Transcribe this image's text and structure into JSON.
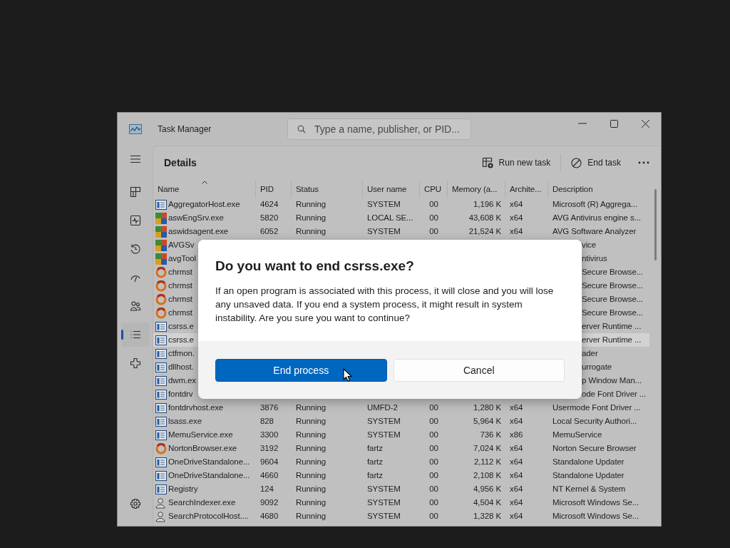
{
  "window": {
    "title": "Task Manager"
  },
  "search": {
    "placeholder": "Type a name, publisher, or PID..."
  },
  "nav": [
    {
      "kind": "menu",
      "selected": false
    },
    {
      "kind": "processes",
      "selected": false
    },
    {
      "kind": "performance",
      "selected": false
    },
    {
      "kind": "history",
      "selected": false
    },
    {
      "kind": "startup",
      "selected": false
    },
    {
      "kind": "users",
      "selected": false
    },
    {
      "kind": "details",
      "selected": true
    },
    {
      "kind": "services",
      "selected": false
    },
    {
      "kind": "settings",
      "selected": false
    }
  ],
  "page": {
    "title": "Details",
    "actions": [
      {
        "label": "Run new task",
        "kind": "run"
      },
      {
        "label": "End task",
        "kind": "end"
      }
    ]
  },
  "table": {
    "columns": [
      "Name",
      "PID",
      "Status",
      "User name",
      "CPU",
      "Memory (a...",
      "Archite...",
      "Description"
    ],
    "rows": [
      {
        "kind": "app",
        "selected": false,
        "cells": [
          "AggregatorHost.exe",
          "4624",
          "Running",
          "SYSTEM",
          "00",
          "1,196 K",
          "x64",
          "Microsoft (R) Aggrega..."
        ]
      },
      {
        "kind": "avg",
        "selected": false,
        "cells": [
          "aswEngSrv.exe",
          "5820",
          "Running",
          "LOCAL SE...",
          "00",
          "43,608 K",
          "x64",
          "AVG Antivirus engine s..."
        ]
      },
      {
        "kind": "avg",
        "selected": false,
        "cells": [
          "aswidsagent.exe",
          "6052",
          "Running",
          "SYSTEM",
          "00",
          "21,524 K",
          "x64",
          "AVG Software Analyzer"
        ]
      },
      {
        "kind": "avg",
        "selected": false,
        "cells": [
          "AVGSv",
          "vice"
        ]
      },
      {
        "kind": "avg",
        "selected": false,
        "cells": [
          "avgTool",
          "ntivirus"
        ]
      },
      {
        "kind": "ring",
        "selected": false,
        "cells": [
          "chrmst",
          "Secure Browse..."
        ]
      },
      {
        "kind": "ring",
        "selected": false,
        "cells": [
          "chrmst",
          "Secure Browse..."
        ]
      },
      {
        "kind": "ring",
        "selected": false,
        "cells": [
          "chrmst",
          "Secure Browse..."
        ]
      },
      {
        "kind": "ring",
        "selected": false,
        "cells": [
          "chrmst",
          "Secure Browse..."
        ]
      },
      {
        "kind": "app",
        "selected": false,
        "cells": [
          "csrss.e",
          "erver Runtime ..."
        ]
      },
      {
        "kind": "app",
        "selected": true,
        "cells": [
          "csrss.e",
          "erver Runtime ..."
        ]
      },
      {
        "kind": "app",
        "selected": false,
        "cells": [
          "ctfmon.",
          "ader"
        ]
      },
      {
        "kind": "app",
        "selected": false,
        "cells": [
          "dllhost.",
          "urrogate"
        ]
      },
      {
        "kind": "app",
        "selected": false,
        "cells": [
          "dwm.ex",
          "p Window Man..."
        ]
      },
      {
        "kind": "app",
        "selected": false,
        "cells": [
          "fontdrv",
          "ode Font Driver ..."
        ]
      },
      {
        "kind": "app",
        "selected": false,
        "cells": [
          "fontdrvhost.exe",
          "3876",
          "Running",
          "UMFD-2",
          "00",
          "1,280 K",
          "x64",
          "Usermode Font Driver ..."
        ]
      },
      {
        "kind": "app",
        "selected": false,
        "cells": [
          "lsass.exe",
          "828",
          "Running",
          "SYSTEM",
          "00",
          "5,964 K",
          "x64",
          "Local Security Authori..."
        ]
      },
      {
        "kind": "app",
        "selected": false,
        "cells": [
          "MemuService.exe",
          "3300",
          "Running",
          "SYSTEM",
          "00",
          "736 K",
          "x86",
          "MemuService"
        ]
      },
      {
        "kind": "ring",
        "selected": false,
        "cells": [
          "NortonBrowser.exe",
          "3192",
          "Running",
          "fartz",
          "00",
          "7,024 K",
          "x64",
          "Norton Secure Browser"
        ]
      },
      {
        "kind": "app",
        "selected": false,
        "cells": [
          "OneDriveStandalone...",
          "9604",
          "Running",
          "fartz",
          "00",
          "2,112 K",
          "x64",
          "Standalone Updater"
        ]
      },
      {
        "kind": "app",
        "selected": false,
        "cells": [
          "OneDriveStandalone...",
          "4660",
          "Running",
          "fartz",
          "00",
          "2,108 K",
          "x64",
          "Standalone Updater"
        ]
      },
      {
        "kind": "app",
        "selected": false,
        "cells": [
          "Registry",
          "124",
          "Running",
          "SYSTEM",
          "00",
          "4,956 K",
          "x64",
          "NT Kernel & System"
        ]
      },
      {
        "kind": "person",
        "selected": false,
        "cells": [
          "SearchIndexer.exe",
          "9092",
          "Running",
          "SYSTEM",
          "00",
          "4,504 K",
          "x64",
          "Microsoft Windows Se..."
        ]
      },
      {
        "kind": "person",
        "selected": false,
        "cells": [
          "SearchProtocolHost....",
          "4680",
          "Running",
          "SYSTEM",
          "00",
          "1,328 K",
          "x64",
          "Microsoft Windows Se..."
        ]
      }
    ]
  },
  "dialog": {
    "title": "Do you want to end csrss.exe?",
    "message": "If an open program is associated with this process, it will close and you will lose any unsaved data. If you end a system process, it might result in system instability. Are you sure you want to continue?",
    "buttons": [
      {
        "label": "End process",
        "kind": "primary"
      },
      {
        "label": "Cancel",
        "kind": "secondary"
      }
    ]
  }
}
